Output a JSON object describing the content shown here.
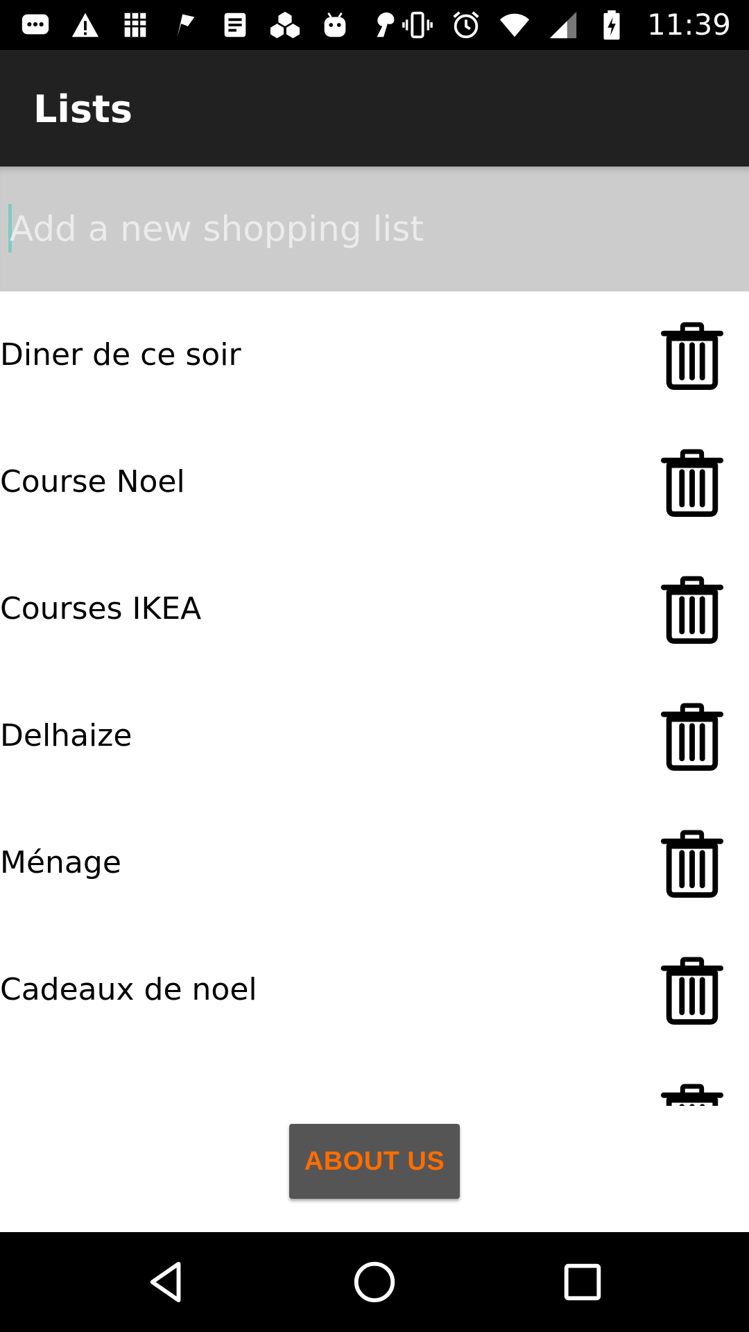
{
  "status_bar": {
    "time": "11:39",
    "left_icons": [
      "message-icon",
      "warning-icon",
      "scan-icon",
      "flag-icon",
      "note-icon",
      "hexagons-icon",
      "android-icon",
      "tool-icon"
    ],
    "right_icons": [
      "vibrate-icon",
      "alarm-icon",
      "wifi-icon",
      "signal-icon",
      "battery-charging-icon"
    ]
  },
  "app_bar": {
    "title": "Lists"
  },
  "new_list": {
    "value": "",
    "placeholder": "Add a new shopping list"
  },
  "lists": [
    {
      "name": "Diner de ce soir"
    },
    {
      "name": "Course Noel"
    },
    {
      "name": "Courses IKEA"
    },
    {
      "name": "Delhaize"
    },
    {
      "name": "Ménage"
    },
    {
      "name": "Cadeaux de noel"
    },
    {
      "name": ""
    }
  ],
  "footer": {
    "about_label": "ABOUT US"
  },
  "colors": {
    "app_bar": "#212121",
    "input_bar": "#cccccc",
    "about_button_bg": "#555555",
    "about_button_text": "#ff6d00",
    "cursor": "#80cbc4"
  }
}
